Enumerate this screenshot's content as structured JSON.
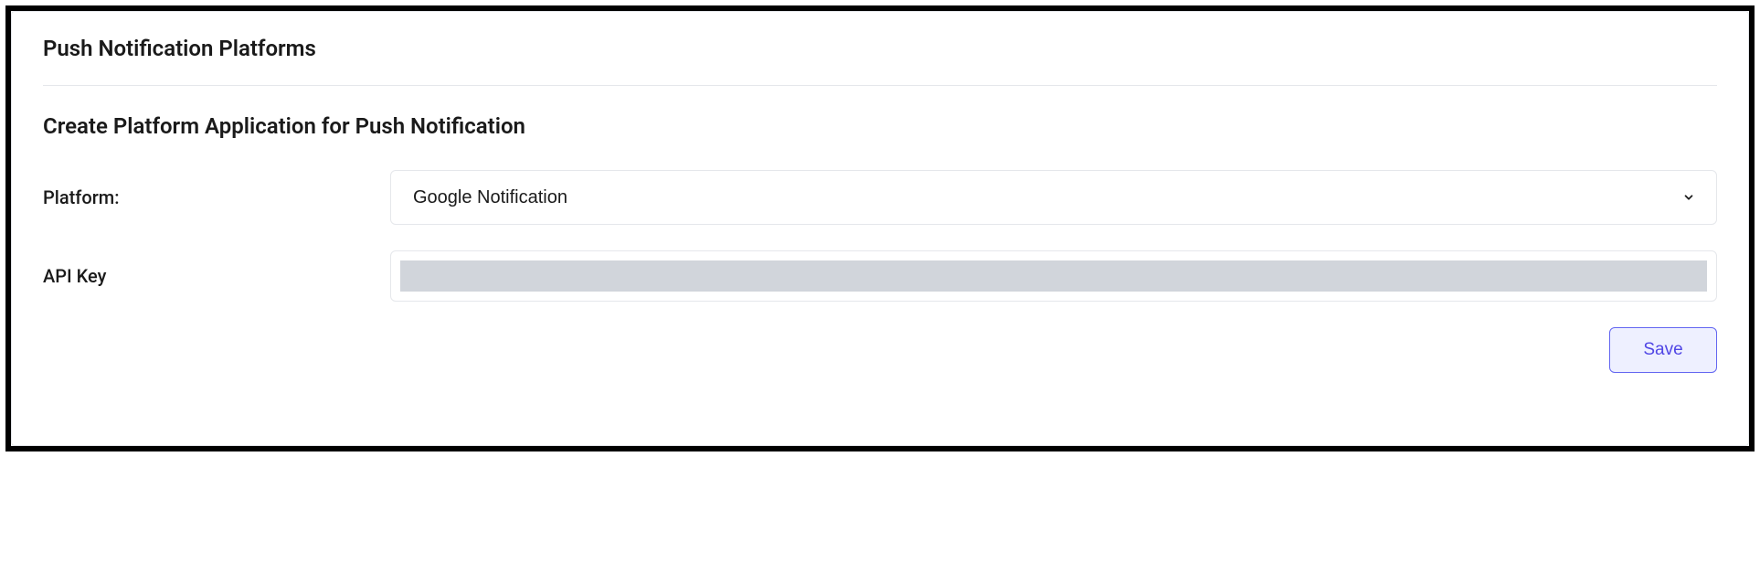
{
  "section": {
    "title": "Push Notification Platforms",
    "subtitle": "Create Platform Application for Push Notification"
  },
  "form": {
    "platform": {
      "label": "Platform:",
      "selected": "Google Notification"
    },
    "apiKey": {
      "label": "API Key",
      "value": ""
    }
  },
  "buttons": {
    "save": "Save"
  }
}
